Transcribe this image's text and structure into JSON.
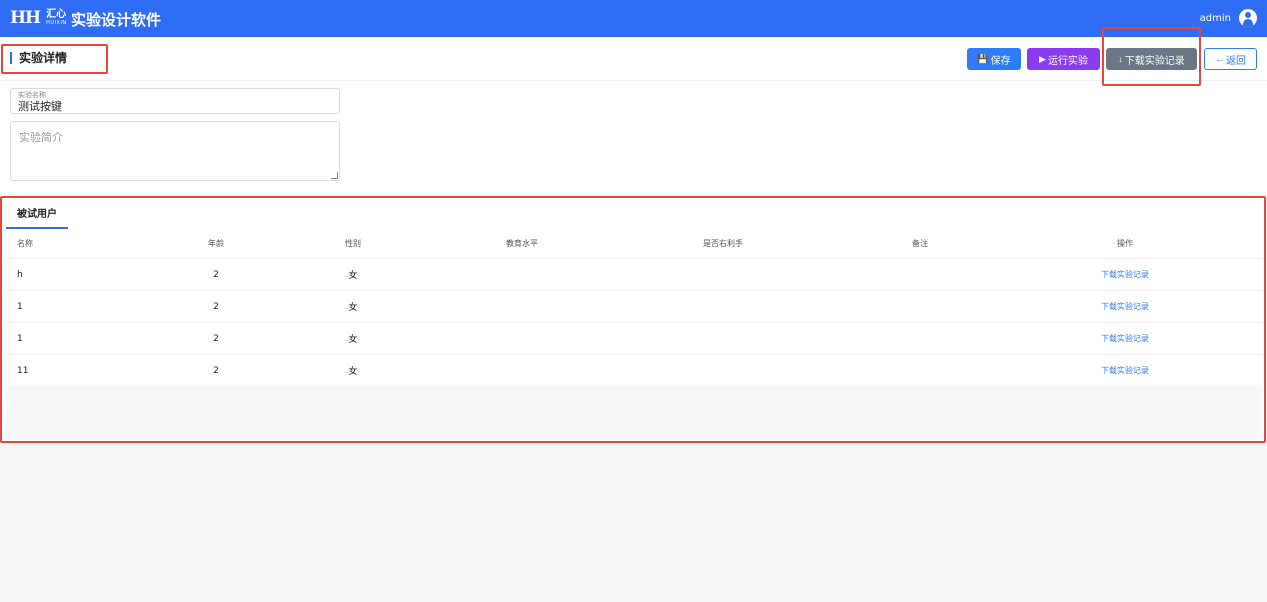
{
  "topbar": {
    "logo_mark": "HH",
    "logo_cn": "汇心",
    "logo_en": "HUIXIN",
    "app_title": "实验设计软件",
    "username": "admin"
  },
  "detail": {
    "title": "实验详情",
    "buttons": {
      "save": "保存",
      "run": "运行实验",
      "download": "下载实验记录",
      "back": "返回"
    },
    "name_field": {
      "label": "实验名称",
      "value": "测试按键"
    },
    "desc_field": {
      "placeholder": "实验简介"
    }
  },
  "users": {
    "tab": "被试用户",
    "columns": [
      "名称",
      "年龄",
      "性别",
      "教育水平",
      "是否右利手",
      "备注",
      "操作"
    ],
    "rows": [
      {
        "name": "h",
        "age": "2",
        "gender": "女",
        "education": "",
        "right_handed": "",
        "note": "",
        "action": "下载实验记录"
      },
      {
        "name": "1",
        "age": "2",
        "gender": "女",
        "education": "",
        "right_handed": "",
        "note": "",
        "action": "下载实验记录"
      },
      {
        "name": "1",
        "age": "2",
        "gender": "女",
        "education": "",
        "right_handed": "",
        "note": "",
        "action": "下载实验记录"
      },
      {
        "name": "11",
        "age": "2",
        "gender": "女",
        "education": "",
        "right_handed": "",
        "note": "",
        "action": "下载实验记录"
      }
    ]
  },
  "colors": {
    "primary": "#2f6df6",
    "run": "#8b3cf0",
    "download": "#6b7785",
    "highlight": "#e8453c"
  }
}
